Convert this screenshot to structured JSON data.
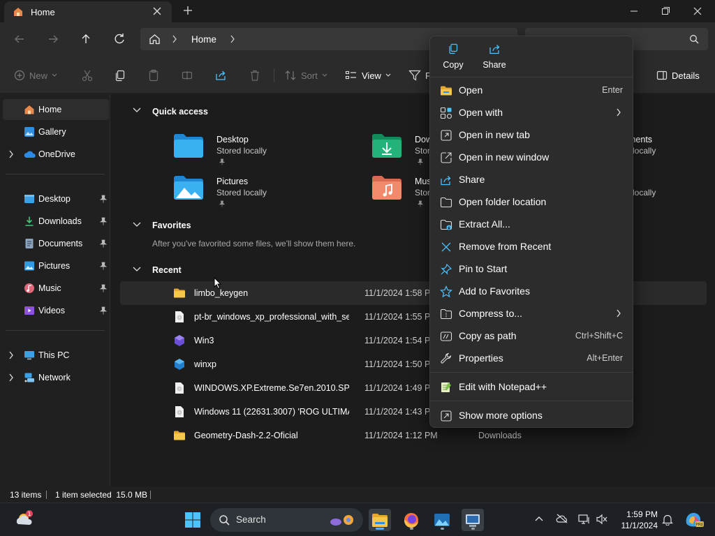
{
  "titlebar": {
    "tab_title": "Home",
    "new_tab_symbol": "+"
  },
  "address": {
    "segments": [
      "Home"
    ]
  },
  "toolbar": {
    "new_label": "New",
    "sort_label": "Sort",
    "view_label": "View",
    "filter_label": "F",
    "details_label": "Details"
  },
  "sidebar": {
    "items": [
      {
        "label": "Home",
        "icon": "home-icon"
      },
      {
        "label": "Gallery",
        "icon": "gallery-icon"
      },
      {
        "label": "OneDrive",
        "icon": "onedrive-icon"
      },
      {
        "label": "Desktop",
        "icon": "desktop-folder-icon"
      },
      {
        "label": "Downloads",
        "icon": "downloads-folder-icon"
      },
      {
        "label": "Documents",
        "icon": "documents-folder-icon"
      },
      {
        "label": "Pictures",
        "icon": "pictures-folder-icon"
      },
      {
        "label": "Music",
        "icon": "music-folder-icon"
      },
      {
        "label": "Videos",
        "icon": "videos-folder-icon"
      },
      {
        "label": "This PC",
        "icon": "this-pc-icon"
      },
      {
        "label": "Network",
        "icon": "network-icon"
      }
    ]
  },
  "main": {
    "quick_access_heading": "Quick access",
    "quick_access": [
      {
        "name": "Desktop",
        "status": "Stored locally"
      },
      {
        "name": "Dow",
        "status": "Store"
      },
      {
        "name": "ments",
        "status": "l locally"
      },
      {
        "name": "Pictures",
        "status": "Stored locally"
      },
      {
        "name": "Musi",
        "status": "Store"
      },
      {
        "name": "s",
        "status": "l locally"
      }
    ],
    "favorites_heading": "Favorites",
    "favorites_empty": "After you've favorited some files, we'll show them here.",
    "recent_heading": "Recent",
    "recent": [
      {
        "name": "limbo_keygen",
        "date": "11/1/2024 1:58 PI",
        "location": ""
      },
      {
        "name": "pt-br_windows_xp_professional_with_se...",
        "date": "11/1/2024 1:55 PI",
        "location": ""
      },
      {
        "name": "Win3",
        "date": "11/1/2024 1:54 PI",
        "location": ""
      },
      {
        "name": "winxp",
        "date": "11/1/2024 1:50 PI",
        "location": ""
      },
      {
        "name": "WINDOWS.XP.Extreme.Se7en.2010.SP3....",
        "date": "11/1/2024 1:49 PI",
        "location": ""
      },
      {
        "name": "Windows 11 (22631.3007) 'ROG ULTIMA...",
        "date": "11/1/2024 1:43 PI",
        "location": ""
      },
      {
        "name": "Geometry-Dash-2.2-Oficial",
        "date": "11/1/2024 1:12 PM",
        "location": "Downloads"
      }
    ]
  },
  "statusbar": {
    "items_count": "13 items",
    "selection": "1 item selected  15.0 MB"
  },
  "taskbar": {
    "search_label": "Search",
    "clock_time": "1:59 PM",
    "clock_date": "11/1/2024"
  },
  "context_menu": {
    "quick_actions": [
      {
        "label": "Copy",
        "icon": "copy-icon"
      },
      {
        "label": "Share",
        "icon": "share-icon"
      }
    ],
    "items": [
      {
        "label": "Open",
        "shortcut": "Enter",
        "icon": "open-folder-icon"
      },
      {
        "label": "Open with",
        "shortcut": "",
        "icon": "open-with-icon"
      },
      {
        "label": "Open in new tab",
        "shortcut": "",
        "icon": "new-tab-icon"
      },
      {
        "label": "Open in new window",
        "shortcut": "",
        "icon": "new-window-icon"
      },
      {
        "label": "Share",
        "shortcut": "",
        "icon": "share-icon"
      },
      {
        "label": "Open folder location",
        "shortcut": "",
        "icon": "folder-location-icon"
      },
      {
        "label": "Extract All...",
        "shortcut": "",
        "icon": "extract-icon"
      },
      {
        "label": "Remove from Recent",
        "shortcut": "",
        "icon": "remove-icon"
      },
      {
        "label": "Pin to Start",
        "shortcut": "",
        "icon": "pin-icon"
      },
      {
        "label": "Add to Favorites",
        "shortcut": "",
        "icon": "star-icon"
      },
      {
        "label": "Compress to...",
        "shortcut": "",
        "icon": "compress-icon"
      },
      {
        "label": "Copy as path",
        "shortcut": "Ctrl+Shift+C",
        "icon": "copy-path-icon"
      },
      {
        "label": "Properties",
        "shortcut": "Alt+Enter",
        "icon": "wrench-icon"
      },
      {
        "label": "Edit with Notepad++",
        "shortcut": "",
        "icon": "notepadpp-icon"
      },
      {
        "label": "Show more options",
        "shortcut": "",
        "icon": "more-options-icon"
      }
    ]
  },
  "colors": {
    "accent": "#4cc2ff",
    "folder_yellow": "#f5c84b",
    "menu_bg": "#2c2c2c"
  }
}
